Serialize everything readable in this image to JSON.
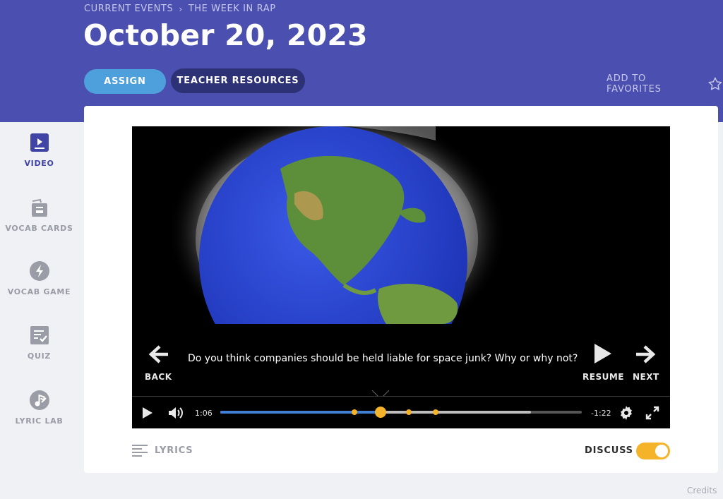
{
  "breadcrumb": {
    "items": [
      "CURRENT EVENTS",
      "THE WEEK IN RAP"
    ],
    "separator": "›"
  },
  "page_title": "October 20, 2023",
  "actions": {
    "assign_label": "ASSIGN",
    "resources_label": "TEACHER RESOURCES",
    "favorites_label": "ADD TO FAVORITES"
  },
  "sidebar": {
    "items": [
      {
        "label": "VIDEO",
        "icon": "video-icon",
        "active": true
      },
      {
        "label": "VOCAB CARDS",
        "icon": "vocab-cards-icon",
        "active": false
      },
      {
        "label": "VOCAB GAME",
        "icon": "lightning-icon",
        "active": false
      },
      {
        "label": "QUIZ",
        "icon": "quiz-icon",
        "active": false
      },
      {
        "label": "LYRIC LAB",
        "icon": "music-note-icon",
        "active": false
      }
    ]
  },
  "player": {
    "question": "Do you think companies should be held liable for space junk? Why or why not?",
    "back_label": "BACK",
    "resume_label": "RESUME",
    "next_label": "NEXT",
    "elapsed": "1:06",
    "remaining": "-1:22",
    "progress_fraction": 0.444,
    "buffered_fraction": 0.86,
    "marker_fractions": [
      0.371,
      0.521,
      0.596
    ]
  },
  "footer": {
    "lyrics_label": "LYRICS",
    "discuss_label": "DISCUSS",
    "discuss_on": true
  },
  "credits_label": "Credits",
  "colors": {
    "header": "#4b4fb0",
    "assign": "#4ea0dd",
    "resources": "#2d3276",
    "accent": "#f5b32a",
    "played": "#3f7fd6"
  }
}
